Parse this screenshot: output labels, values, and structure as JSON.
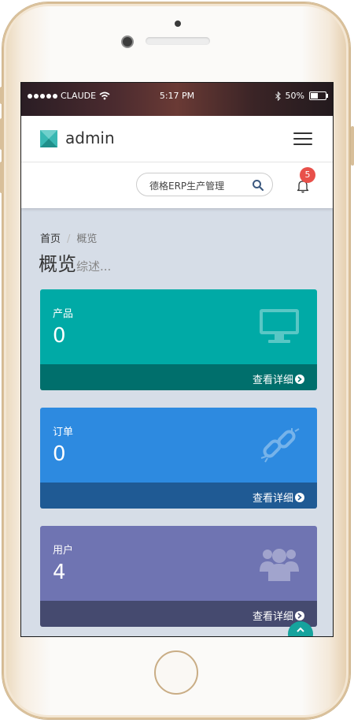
{
  "statusbar": {
    "carrier": "CLAUDE",
    "time": "5:17 PM",
    "battery": "50%",
    "battery_level": 0.5
  },
  "navbar": {
    "brand": "admin"
  },
  "toolbar": {
    "search_text": "德格ERP生产管理",
    "notification_count": "5"
  },
  "breadcrumb": {
    "home": "首页",
    "current": "概览"
  },
  "page": {
    "title": "概览",
    "subtitle": "综述..."
  },
  "cards": [
    {
      "label": "产品",
      "count": "0",
      "more": "查看详细",
      "icon": "monitor-icon",
      "color": "#00aaa6",
      "footer_color": "#006f6c"
    },
    {
      "label": "订单",
      "count": "0",
      "more": "查看详细",
      "icon": "broken-link-icon",
      "color": "#2d8ae0",
      "footer_color": "#1f5a94"
    },
    {
      "label": "用户",
      "count": "4",
      "more": "查看详细",
      "icon": "users-icon",
      "color": "#6f74b2",
      "footer_color": "#454a6f"
    }
  ]
}
